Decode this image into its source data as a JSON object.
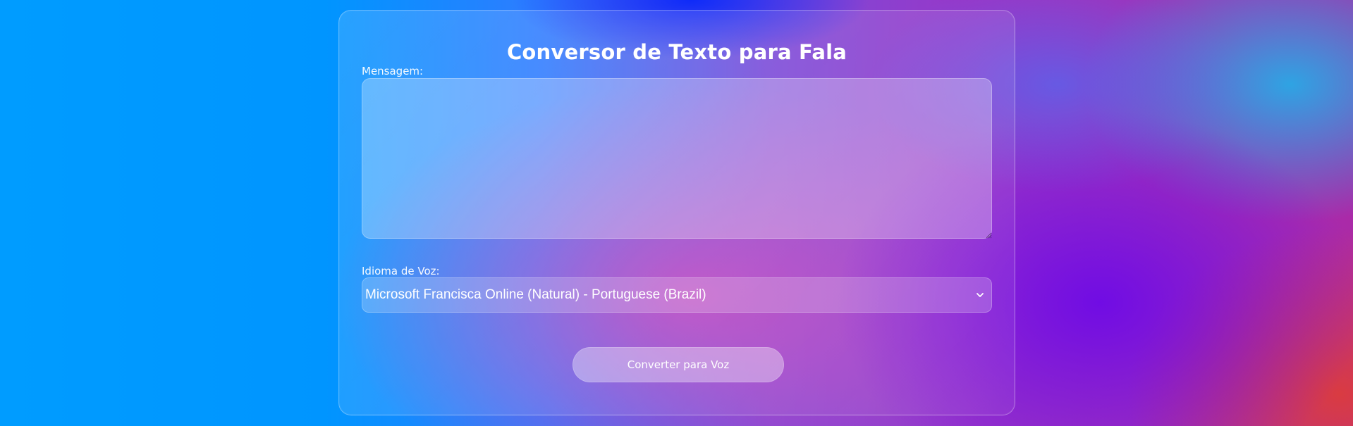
{
  "page": {
    "title": "Conversor de Texto para Fala"
  },
  "form": {
    "message_label": "Mensagem:",
    "message_value": "",
    "voice_label": "Idioma de Voz:",
    "voice_selected": "Microsoft Francisca Online (Natural) - Portuguese (Brazil)",
    "convert_button_label": "Converter para Voz"
  },
  "icons": {
    "resize_grip": "resize-grip-icon",
    "dropdown": "chevron-down-icon"
  },
  "colors": {
    "text_primary": "#ffffff",
    "background_left": "#009cff",
    "background_mid": "#7c4bd8",
    "background_right": "#d84757"
  }
}
